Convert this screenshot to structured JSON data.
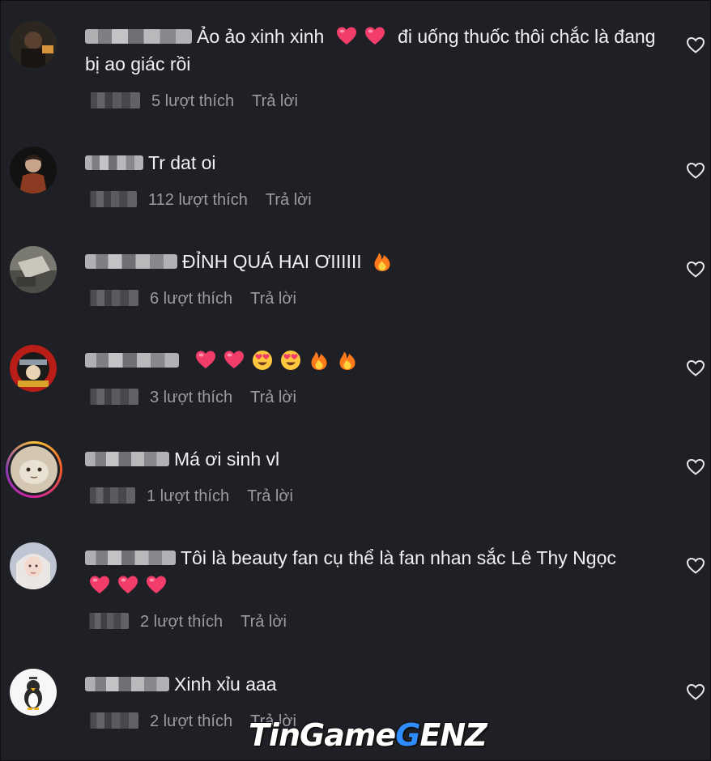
{
  "colors": {
    "background": "#1f2025",
    "text": "#f1f1f1",
    "meta_text": "#9b9ca2",
    "heart_emoji": "#f23d6b",
    "fire_emoji": "#ff8a1c"
  },
  "comments": [
    {
      "text_before": "Ảo ảo xinh xinh",
      "emojis": [
        "red-heart",
        "red-heart"
      ],
      "text_after": "đi uống thuốc thôi chắc là đang bị ao giác rồi",
      "likes": "5 lượt thích",
      "reply": "Trả lời"
    },
    {
      "text_before": "Tr dat oi",
      "emojis": [],
      "text_after": "",
      "likes": "112 lượt thích",
      "reply": "Trả lời"
    },
    {
      "text_before": "ĐỈNH QUÁ HAI ƠIIIIII",
      "emojis": [
        "fire"
      ],
      "text_after": "",
      "likes": "6 lượt thích",
      "reply": "Trả lời"
    },
    {
      "text_before": "",
      "emojis": [
        "red-heart",
        "red-heart",
        "heart-eyes",
        "heart-eyes",
        "fire",
        "fire"
      ],
      "text_after": "",
      "likes": "3 lượt thích",
      "reply": "Trả lời"
    },
    {
      "text_before": "Má ơi sinh vl",
      "emojis": [],
      "text_after": "",
      "likes": "1 lượt thích",
      "reply": "Trả lời"
    },
    {
      "text_before": "Tôi là beauty fan cụ thể là fan nhan sắc Lê Thy Ngọc",
      "emojis": [
        "red-heart",
        "red-heart",
        "red-heart"
      ],
      "text_after": "",
      "likes": "2 lượt thích",
      "reply": "Trả lời"
    },
    {
      "text_before": "Xinh xỉu aaa",
      "emojis": [],
      "text_after": "",
      "likes": "2 lượt thích",
      "reply": "Trả lời"
    }
  ],
  "watermark": {
    "part1": "TinGame",
    "part2": "G",
    "part3": "ENZ"
  },
  "icons": {
    "like_button": "heart-outline-icon",
    "username": "blurred-username",
    "timestamp": "blurred-timestamp"
  }
}
